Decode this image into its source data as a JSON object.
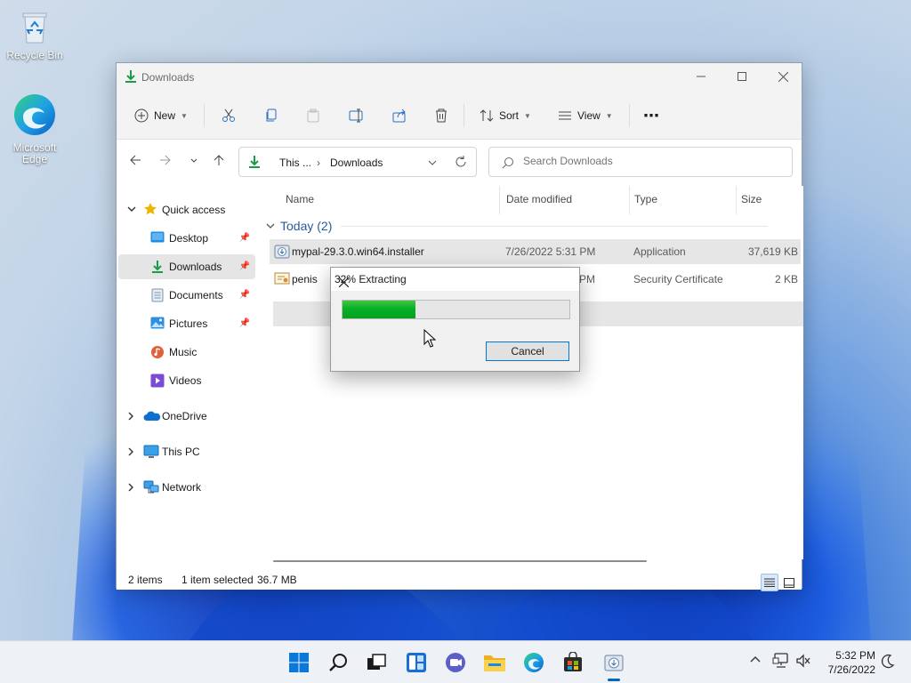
{
  "desktop": {
    "icons": [
      {
        "label": "Recycle Bin",
        "icon": "recycle-bin-icon"
      },
      {
        "label": "Microsoft Edge",
        "icon": "edge-icon"
      }
    ]
  },
  "window": {
    "title": "Downloads",
    "toolbar": {
      "new_label": "New",
      "sort_label": "Sort",
      "view_label": "View",
      "more_label": "⋯"
    },
    "address": {
      "crumbs": [
        "This ...",
        "Downloads"
      ]
    },
    "search": {
      "placeholder": "Search Downloads"
    },
    "nav": {
      "quick_access": "Quick access",
      "items": [
        {
          "label": "Desktop",
          "pinned": true
        },
        {
          "label": "Downloads",
          "pinned": true,
          "selected": true
        },
        {
          "label": "Documents",
          "pinned": true
        },
        {
          "label": "Pictures",
          "pinned": true
        },
        {
          "label": "Music",
          "pinned": false
        },
        {
          "label": "Videos",
          "pinned": false
        }
      ],
      "onedrive": "OneDrive",
      "this_pc": "This PC",
      "network": "Network"
    },
    "columns": [
      "Name",
      "Date modified",
      "Type",
      "Size"
    ],
    "group": {
      "label": "Today (2)"
    },
    "files": [
      {
        "name": "mypal-29.3.0.win64.installer",
        "date": "7/26/2022 5:31 PM",
        "type": "Application",
        "size": "37,619 KB",
        "selected": true
      },
      {
        "name": "penis",
        "date": "7/26/2022 5:31 PM",
        "date_visible": "PM",
        "type": "Security Certificate",
        "size": "2 KB",
        "selected": false
      }
    ],
    "status": {
      "items": "2 items",
      "selected": "1 item selected",
      "size": "36.7 MB"
    }
  },
  "dialog": {
    "title": "32% Extracting",
    "progress": 0.32,
    "cancel_label": "Cancel"
  },
  "taskbar": {
    "apps": [
      "start-icon",
      "search-icon",
      "task-view-icon",
      "widgets-icon",
      "chat-icon",
      "file-explorer-icon",
      "edge-icon",
      "store-icon",
      "installer-icon"
    ],
    "clock": {
      "time": "5:32 PM",
      "date": "7/26/2022"
    }
  },
  "colors": {
    "accent": "#0067c0",
    "progress_fill": "#06b025",
    "group_header": "#2a5b9c",
    "downloads_green": "#1a9a4b"
  }
}
